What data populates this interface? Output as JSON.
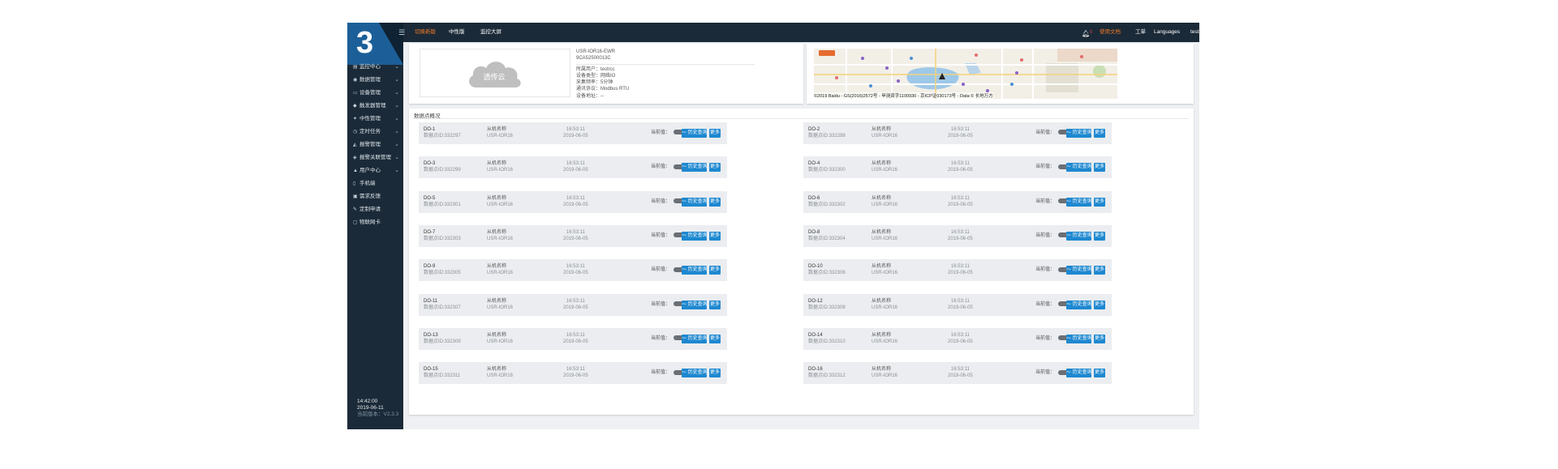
{
  "logo": {
    "number": "3"
  },
  "topbar": {
    "nav": [
      "切换新版",
      "中性版",
      "监控大屏"
    ],
    "alert_count": "0",
    "right": [
      "使用文档",
      "工单",
      "Languages",
      "testrcc"
    ]
  },
  "sidebar": {
    "items": [
      {
        "label": "监控中心",
        "icon": "monitor-icon",
        "expandable": true
      },
      {
        "label": "数据管理",
        "icon": "data-icon",
        "expandable": true
      },
      {
        "label": "设备管理",
        "icon": "device-icon",
        "expandable": true
      },
      {
        "label": "触发器管理",
        "icon": "trigger-icon",
        "expandable": true
      },
      {
        "label": "中性管理",
        "icon": "pin-icon",
        "expandable": true
      },
      {
        "label": "定时任务",
        "icon": "clock-icon",
        "expandable": true
      },
      {
        "label": "报警管理",
        "icon": "alarm-icon",
        "expandable": true
      },
      {
        "label": "报警关联管理",
        "icon": "link-icon",
        "expandable": true
      },
      {
        "label": "用户中心",
        "icon": "user-icon",
        "expandable": true
      },
      {
        "label": "手机端",
        "icon": "phone-icon",
        "expandable": false
      },
      {
        "label": "需求反馈",
        "icon": "feedback-icon",
        "expandable": false
      },
      {
        "label": "定制申请",
        "icon": "edit-icon",
        "expandable": false
      },
      {
        "label": "物联网卡",
        "icon": "card-icon",
        "expandable": false
      }
    ],
    "time": "14:42:00",
    "date": "2019-06-11",
    "version": "当前版本：V2.3.3"
  },
  "device": {
    "cloud_text": "透传云",
    "name": "USR-IOR16-EWR",
    "id": "9CA52500013C",
    "owner": "所属用户：testrcc",
    "type": "设备类型：网络IO",
    "interval": "采集频率：5分钟",
    "protocol": "通讯协议：Modbus RTU",
    "address": "设备地址：--"
  },
  "map": {
    "caption": "©2019 Baidu - GS(2016)2572号 - 甲测资字1100930 - 京ICP证030173号 - Data © 长地万方"
  },
  "section": {
    "title": "数据点概况",
    "labels": {
      "current_value": "当前值：",
      "history": "历史查询",
      "more": "更多"
    },
    "points": [
      {
        "name": "DO-1",
        "pid": "数据点ID:332297",
        "slave": "从机名称",
        "model": "USR-IOR16",
        "time": "16:53:11",
        "date": "2019-06-05",
        "value": 0
      },
      {
        "name": "DO-2",
        "pid": "数据点ID:332298",
        "slave": "从机名称",
        "model": "USR-IOR16",
        "time": "16:53:11",
        "date": "2019-06-05",
        "value": 0
      },
      {
        "name": "DO-3",
        "pid": "数据点ID:332299",
        "slave": "从机名称",
        "model": "USR-IOR16",
        "time": "16:53:11",
        "date": "2019-06-05",
        "value": 0
      },
      {
        "name": "DO-4",
        "pid": "数据点ID:332300",
        "slave": "从机名称",
        "model": "USR-IOR16",
        "time": "16:53:11",
        "date": "2019-06-05",
        "value": 0
      },
      {
        "name": "DO-5",
        "pid": "数据点ID:332301",
        "slave": "从机名称",
        "model": "USR-IOR16",
        "time": "16:53:11",
        "date": "2019-06-05",
        "value": 0
      },
      {
        "name": "DO-6",
        "pid": "数据点ID:332302",
        "slave": "从机名称",
        "model": "USR-IOR16",
        "time": "16:53:11",
        "date": "2019-06-05",
        "value": 0
      },
      {
        "name": "DO-7",
        "pid": "数据点ID:332303",
        "slave": "从机名称",
        "model": "USR-IOR16",
        "time": "16:53:11",
        "date": "2019-06-05",
        "value": 0
      },
      {
        "name": "DO-8",
        "pid": "数据点ID:332304",
        "slave": "从机名称",
        "model": "USR-IOR16",
        "time": "16:53:11",
        "date": "2019-06-05",
        "value": 0
      },
      {
        "name": "DO-9",
        "pid": "数据点ID:332305",
        "slave": "从机名称",
        "model": "USR-IOR16",
        "time": "16:53:11",
        "date": "2019-06-05",
        "value": 0
      },
      {
        "name": "DO-10",
        "pid": "数据点ID:332306",
        "slave": "从机名称",
        "model": "USR-IOR16",
        "time": "16:53:11",
        "date": "2019-06-05",
        "value": 0
      },
      {
        "name": "DO-11",
        "pid": "数据点ID:332307",
        "slave": "从机名称",
        "model": "USR-IOR16",
        "time": "16:53:11",
        "date": "2019-06-05",
        "value": 0
      },
      {
        "name": "DO-12",
        "pid": "数据点ID:332308",
        "slave": "从机名称",
        "model": "USR-IOR16",
        "time": "16:53:11",
        "date": "2019-06-05",
        "value": 0
      },
      {
        "name": "DO-13",
        "pid": "数据点ID:332309",
        "slave": "从机名称",
        "model": "USR-IOR16",
        "time": "16:53:11",
        "date": "2019-06-05",
        "value": 0
      },
      {
        "name": "DO-14",
        "pid": "数据点ID:332310",
        "slave": "从机名称",
        "model": "USR-IOR16",
        "time": "16:53:11",
        "date": "2019-06-05",
        "value": 0
      },
      {
        "name": "DO-15",
        "pid": "数据点ID:332311",
        "slave": "从机名称",
        "model": "USR-IOR16",
        "time": "16:53:11",
        "date": "2019-06-05",
        "value": 0
      },
      {
        "name": "DO-16",
        "pid": "数据点ID:332312",
        "slave": "从机名称",
        "model": "USR-IOR16",
        "time": "16:53:11",
        "date": "2019-06-05",
        "value": 0
      }
    ]
  },
  "colors": {
    "sidebar_bg": "#1b2a38",
    "accent": "#f07a27",
    "button": "#1e88d0",
    "logo_bg": "#1c5f98"
  }
}
